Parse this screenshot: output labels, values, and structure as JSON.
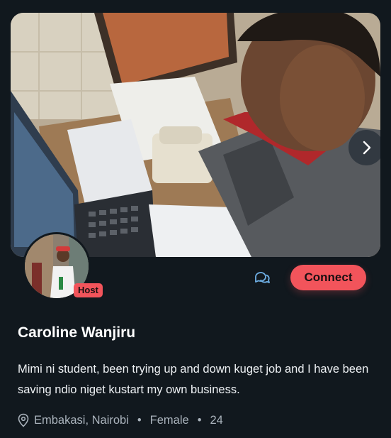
{
  "profile": {
    "name": "Caroline Wanjiru",
    "role_badge": "Host",
    "bio": "Mimi ni student, been trying up and down kuget job and I have been saving ndio niget kustart my own business.",
    "location": "Embakasi, Nairobi",
    "gender": "Female",
    "age": "24"
  },
  "actions": {
    "connect_label": "Connect",
    "message_icon": "chat-bubbles-icon",
    "next_icon": "chevron-right-icon"
  },
  "meta": {
    "separator": "•",
    "location_icon": "map-pin-icon"
  },
  "colors": {
    "accent": "#f2545b",
    "background": "#11181e",
    "icon_blue": "#6fb0e6"
  }
}
